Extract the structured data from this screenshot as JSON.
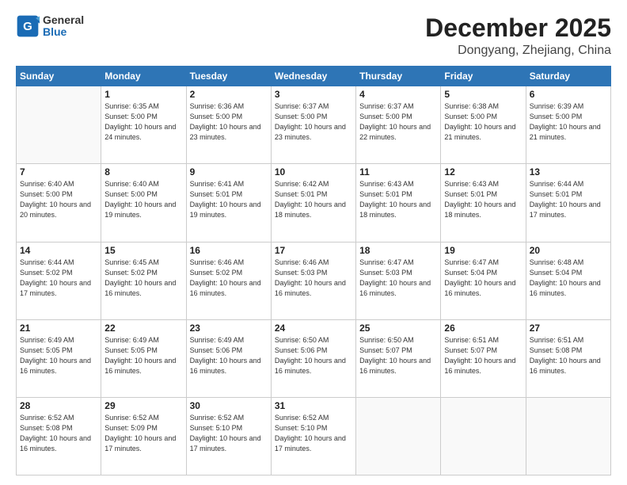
{
  "header": {
    "logo": {
      "general": "General",
      "blue": "Blue"
    },
    "title": "December 2025",
    "subtitle": "Dongyang, Zhejiang, China"
  },
  "weekdays": [
    "Sunday",
    "Monday",
    "Tuesday",
    "Wednesday",
    "Thursday",
    "Friday",
    "Saturday"
  ],
  "weeks": [
    [
      {
        "day": "",
        "info": ""
      },
      {
        "day": "1",
        "info": "Sunrise: 6:35 AM\nSunset: 5:00 PM\nDaylight: 10 hours\nand 24 minutes."
      },
      {
        "day": "2",
        "info": "Sunrise: 6:36 AM\nSunset: 5:00 PM\nDaylight: 10 hours\nand 23 minutes."
      },
      {
        "day": "3",
        "info": "Sunrise: 6:37 AM\nSunset: 5:00 PM\nDaylight: 10 hours\nand 23 minutes."
      },
      {
        "day": "4",
        "info": "Sunrise: 6:37 AM\nSunset: 5:00 PM\nDaylight: 10 hours\nand 22 minutes."
      },
      {
        "day": "5",
        "info": "Sunrise: 6:38 AM\nSunset: 5:00 PM\nDaylight: 10 hours\nand 21 minutes."
      },
      {
        "day": "6",
        "info": "Sunrise: 6:39 AM\nSunset: 5:00 PM\nDaylight: 10 hours\nand 21 minutes."
      }
    ],
    [
      {
        "day": "7",
        "info": "Sunrise: 6:40 AM\nSunset: 5:00 PM\nDaylight: 10 hours\nand 20 minutes."
      },
      {
        "day": "8",
        "info": "Sunrise: 6:40 AM\nSunset: 5:00 PM\nDaylight: 10 hours\nand 19 minutes."
      },
      {
        "day": "9",
        "info": "Sunrise: 6:41 AM\nSunset: 5:01 PM\nDaylight: 10 hours\nand 19 minutes."
      },
      {
        "day": "10",
        "info": "Sunrise: 6:42 AM\nSunset: 5:01 PM\nDaylight: 10 hours\nand 18 minutes."
      },
      {
        "day": "11",
        "info": "Sunrise: 6:43 AM\nSunset: 5:01 PM\nDaylight: 10 hours\nand 18 minutes."
      },
      {
        "day": "12",
        "info": "Sunrise: 6:43 AM\nSunset: 5:01 PM\nDaylight: 10 hours\nand 18 minutes."
      },
      {
        "day": "13",
        "info": "Sunrise: 6:44 AM\nSunset: 5:01 PM\nDaylight: 10 hours\nand 17 minutes."
      }
    ],
    [
      {
        "day": "14",
        "info": "Sunrise: 6:44 AM\nSunset: 5:02 PM\nDaylight: 10 hours\nand 17 minutes."
      },
      {
        "day": "15",
        "info": "Sunrise: 6:45 AM\nSunset: 5:02 PM\nDaylight: 10 hours\nand 16 minutes."
      },
      {
        "day": "16",
        "info": "Sunrise: 6:46 AM\nSunset: 5:02 PM\nDaylight: 10 hours\nand 16 minutes."
      },
      {
        "day": "17",
        "info": "Sunrise: 6:46 AM\nSunset: 5:03 PM\nDaylight: 10 hours\nand 16 minutes."
      },
      {
        "day": "18",
        "info": "Sunrise: 6:47 AM\nSunset: 5:03 PM\nDaylight: 10 hours\nand 16 minutes."
      },
      {
        "day": "19",
        "info": "Sunrise: 6:47 AM\nSunset: 5:04 PM\nDaylight: 10 hours\nand 16 minutes."
      },
      {
        "day": "20",
        "info": "Sunrise: 6:48 AM\nSunset: 5:04 PM\nDaylight: 10 hours\nand 16 minutes."
      }
    ],
    [
      {
        "day": "21",
        "info": "Sunrise: 6:49 AM\nSunset: 5:05 PM\nDaylight: 10 hours\nand 16 minutes."
      },
      {
        "day": "22",
        "info": "Sunrise: 6:49 AM\nSunset: 5:05 PM\nDaylight: 10 hours\nand 16 minutes."
      },
      {
        "day": "23",
        "info": "Sunrise: 6:49 AM\nSunset: 5:06 PM\nDaylight: 10 hours\nand 16 minutes."
      },
      {
        "day": "24",
        "info": "Sunrise: 6:50 AM\nSunset: 5:06 PM\nDaylight: 10 hours\nand 16 minutes."
      },
      {
        "day": "25",
        "info": "Sunrise: 6:50 AM\nSunset: 5:07 PM\nDaylight: 10 hours\nand 16 minutes."
      },
      {
        "day": "26",
        "info": "Sunrise: 6:51 AM\nSunset: 5:07 PM\nDaylight: 10 hours\nand 16 minutes."
      },
      {
        "day": "27",
        "info": "Sunrise: 6:51 AM\nSunset: 5:08 PM\nDaylight: 10 hours\nand 16 minutes."
      }
    ],
    [
      {
        "day": "28",
        "info": "Sunrise: 6:52 AM\nSunset: 5:08 PM\nDaylight: 10 hours\nand 16 minutes."
      },
      {
        "day": "29",
        "info": "Sunrise: 6:52 AM\nSunset: 5:09 PM\nDaylight: 10 hours\nand 17 minutes."
      },
      {
        "day": "30",
        "info": "Sunrise: 6:52 AM\nSunset: 5:10 PM\nDaylight: 10 hours\nand 17 minutes."
      },
      {
        "day": "31",
        "info": "Sunrise: 6:52 AM\nSunset: 5:10 PM\nDaylight: 10 hours\nand 17 minutes."
      },
      {
        "day": "",
        "info": ""
      },
      {
        "day": "",
        "info": ""
      },
      {
        "day": "",
        "info": ""
      }
    ]
  ]
}
